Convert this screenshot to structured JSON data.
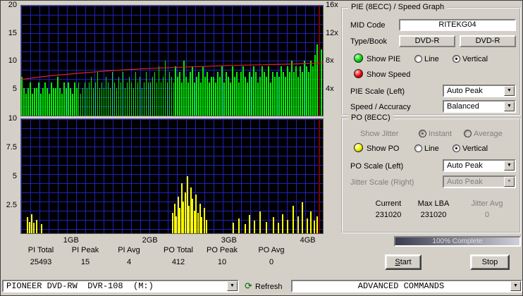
{
  "colors": {
    "window_bg": "#d4d0c8",
    "graph_bg": "#000000",
    "grid": "#2121bb",
    "led_green": "#00d800",
    "led_red": "#ee0000",
    "led_yellow": "#eeee00"
  },
  "stats": {
    "items": [
      {
        "label": "PI Total",
        "value": "25493"
      },
      {
        "label": "PI Peak",
        "value": "15"
      },
      {
        "label": "PI Avg",
        "value": "4"
      },
      {
        "label": "PO Total",
        "value": "412"
      },
      {
        "label": "PO Peak",
        "value": "10"
      },
      {
        "label": "PO Avg",
        "value": "0"
      }
    ]
  },
  "right_panel": {
    "pie_group": {
      "title": "PIE (8ECC) / Speed Graph",
      "mid_code_label": "MID Code",
      "mid_code_value": "RITEKG04",
      "type_book_label": "Type/Book",
      "type_value": "DVD-R",
      "book_value": "DVD-R",
      "show_pie_label": "Show PIE",
      "show_speed_label": "Show Speed",
      "line_label": "Line",
      "vertical_label": "Vertical",
      "pie_scale_label": "PIE Scale (Left)",
      "pie_scale_value": "Auto Peak",
      "speed_accuracy_label": "Speed / Accuracy",
      "speed_accuracy_value": "Balanced"
    },
    "po_group": {
      "title": "PO (8ECC)",
      "show_jitter_label": "Show Jitter",
      "instant_label": "Instant",
      "average_label": "Average",
      "show_po_label": "Show PO",
      "line_label": "Line",
      "vertical_label": "Vertical",
      "po_scale_label": "PO Scale (Left)",
      "po_scale_value": "Auto Peak",
      "jitter_scale_label": "Jitter Scale (Right)",
      "jitter_scale_value": "Auto Peak",
      "current_label": "Current",
      "current_value": "231020",
      "max_lba_label": "Max LBA",
      "max_lba_value": "231020",
      "jitter_avg_label": "Jitter Avg",
      "jitter_avg_value": "0"
    },
    "progress": {
      "text": "100% Complete",
      "percent": 100
    },
    "buttons": {
      "start_first": "S",
      "start_rest": "tart",
      "stop": "Stop"
    }
  },
  "bottom_bar": {
    "drive_value": "PIONEER DVD-RW  DVR-108  (M:)",
    "refresh_label": "Refresh",
    "commands_value": "ADVANCED COMMANDS"
  },
  "chart_data": [
    {
      "type": "bar",
      "name": "PIE (8ECC) / Speed Graph",
      "y_left": {
        "ticks": [
          20,
          15,
          10,
          5
        ],
        "max": 20
      },
      "y_right": {
        "ticks": [
          16,
          12,
          8,
          4
        ],
        "max": 16,
        "suffix": "x"
      },
      "x_ticks": [
        {
          "label": "1GB",
          "f": 0.167
        },
        {
          "label": "2GB",
          "f": 0.427
        },
        {
          "label": "3GB",
          "f": 0.688
        },
        {
          "label": "4GB",
          "f": 0.948
        }
      ],
      "bars": [
        7,
        5,
        4,
        5,
        6,
        4,
        5,
        5,
        6,
        4,
        5,
        6,
        5,
        4,
        6,
        5,
        5,
        7,
        5,
        4,
        6,
        5,
        6,
        5,
        4,
        6,
        5,
        6,
        4,
        5,
        6,
        5,
        6,
        7,
        5,
        6,
        8,
        5,
        6,
        5,
        7,
        6,
        5,
        8,
        6,
        5,
        7,
        6,
        8,
        5,
        6,
        7,
        6,
        5,
        8,
        6,
        7,
        5,
        6,
        8,
        6,
        6,
        7,
        8,
        6,
        9,
        6,
        7,
        10,
        6,
        8,
        7,
        6,
        9,
        7,
        8,
        6,
        10,
        7,
        6,
        8,
        9,
        6,
        7,
        8,
        6,
        9,
        7,
        8,
        6,
        7,
        7,
        6,
        8,
        7,
        9,
        6,
        8,
        7,
        6,
        9,
        7,
        8,
        6,
        8,
        9,
        7,
        6,
        8,
        7,
        9,
        8,
        6,
        7,
        9,
        8,
        7,
        9,
        6,
        8,
        7,
        8,
        7,
        9,
        8,
        7,
        9,
        8,
        10,
        8,
        9,
        7,
        9,
        8,
        10,
        9,
        8,
        10,
        9,
        11,
        13,
        15,
        12
      ],
      "speed_line": [
        [
          0,
          5.25
        ],
        [
          0.05,
          5.55
        ],
        [
          0.1,
          5.8
        ],
        [
          0.2,
          6.2
        ],
        [
          0.3,
          6.55
        ],
        [
          0.4,
          6.8
        ],
        [
          0.5,
          7.0
        ],
        [
          0.6,
          7.15
        ],
        [
          0.7,
          7.3
        ],
        [
          0.8,
          7.4
        ],
        [
          0.9,
          7.5
        ],
        [
          0.97,
          7.6
        ],
        [
          1,
          7.6
        ]
      ],
      "marker_f": 0.985,
      "colors": {
        "bar": "#00ef00",
        "line": "#dd2222",
        "marker": "#7a0000"
      }
    },
    {
      "type": "bar",
      "name": "PO (8ECC)",
      "y_left": {
        "ticks": [
          10,
          7.5,
          5,
          2.5
        ],
        "max": 10
      },
      "bars": [
        [
          0.018,
          1.4
        ],
        [
          0.025,
          1.0
        ],
        [
          0.032,
          1.7
        ],
        [
          0.04,
          0.9
        ],
        [
          0.05,
          1.2
        ],
        [
          0.065,
          0.8
        ],
        [
          0.5,
          1.8
        ],
        [
          0.506,
          2.6
        ],
        [
          0.512,
          1.5
        ],
        [
          0.518,
          3.2
        ],
        [
          0.524,
          2.2
        ],
        [
          0.53,
          4.4
        ],
        [
          0.536,
          2.8
        ],
        [
          0.542,
          3.6
        ],
        [
          0.548,
          5.0
        ],
        [
          0.554,
          2.4
        ],
        [
          0.56,
          4.0
        ],
        [
          0.566,
          3.0
        ],
        [
          0.572,
          2.0
        ],
        [
          0.578,
          3.4
        ],
        [
          0.584,
          1.8
        ],
        [
          0.59,
          2.6
        ],
        [
          0.596,
          1.4
        ],
        [
          0.604,
          2.2
        ],
        [
          0.612,
          1.2
        ],
        [
          0.7,
          0.9
        ],
        [
          0.72,
          1.3
        ],
        [
          0.74,
          0.8
        ],
        [
          0.755,
          1.6
        ],
        [
          0.77,
          1.1
        ],
        [
          0.79,
          1.9
        ],
        [
          0.81,
          1.0
        ],
        [
          0.835,
          1.4
        ],
        [
          0.85,
          0.9
        ],
        [
          0.865,
          1.7
        ],
        [
          0.88,
          1.2
        ],
        [
          0.9,
          2.4
        ],
        [
          0.915,
          1.5
        ],
        [
          0.93,
          2.7
        ],
        [
          0.945,
          1.3
        ],
        [
          0.958,
          1.9
        ],
        [
          0.97,
          1.1
        ],
        [
          0.98,
          1.5
        ]
      ],
      "marker_f": 0.985,
      "colors": {
        "bar": "#ffff00",
        "marker": "#7a0000"
      }
    }
  ]
}
